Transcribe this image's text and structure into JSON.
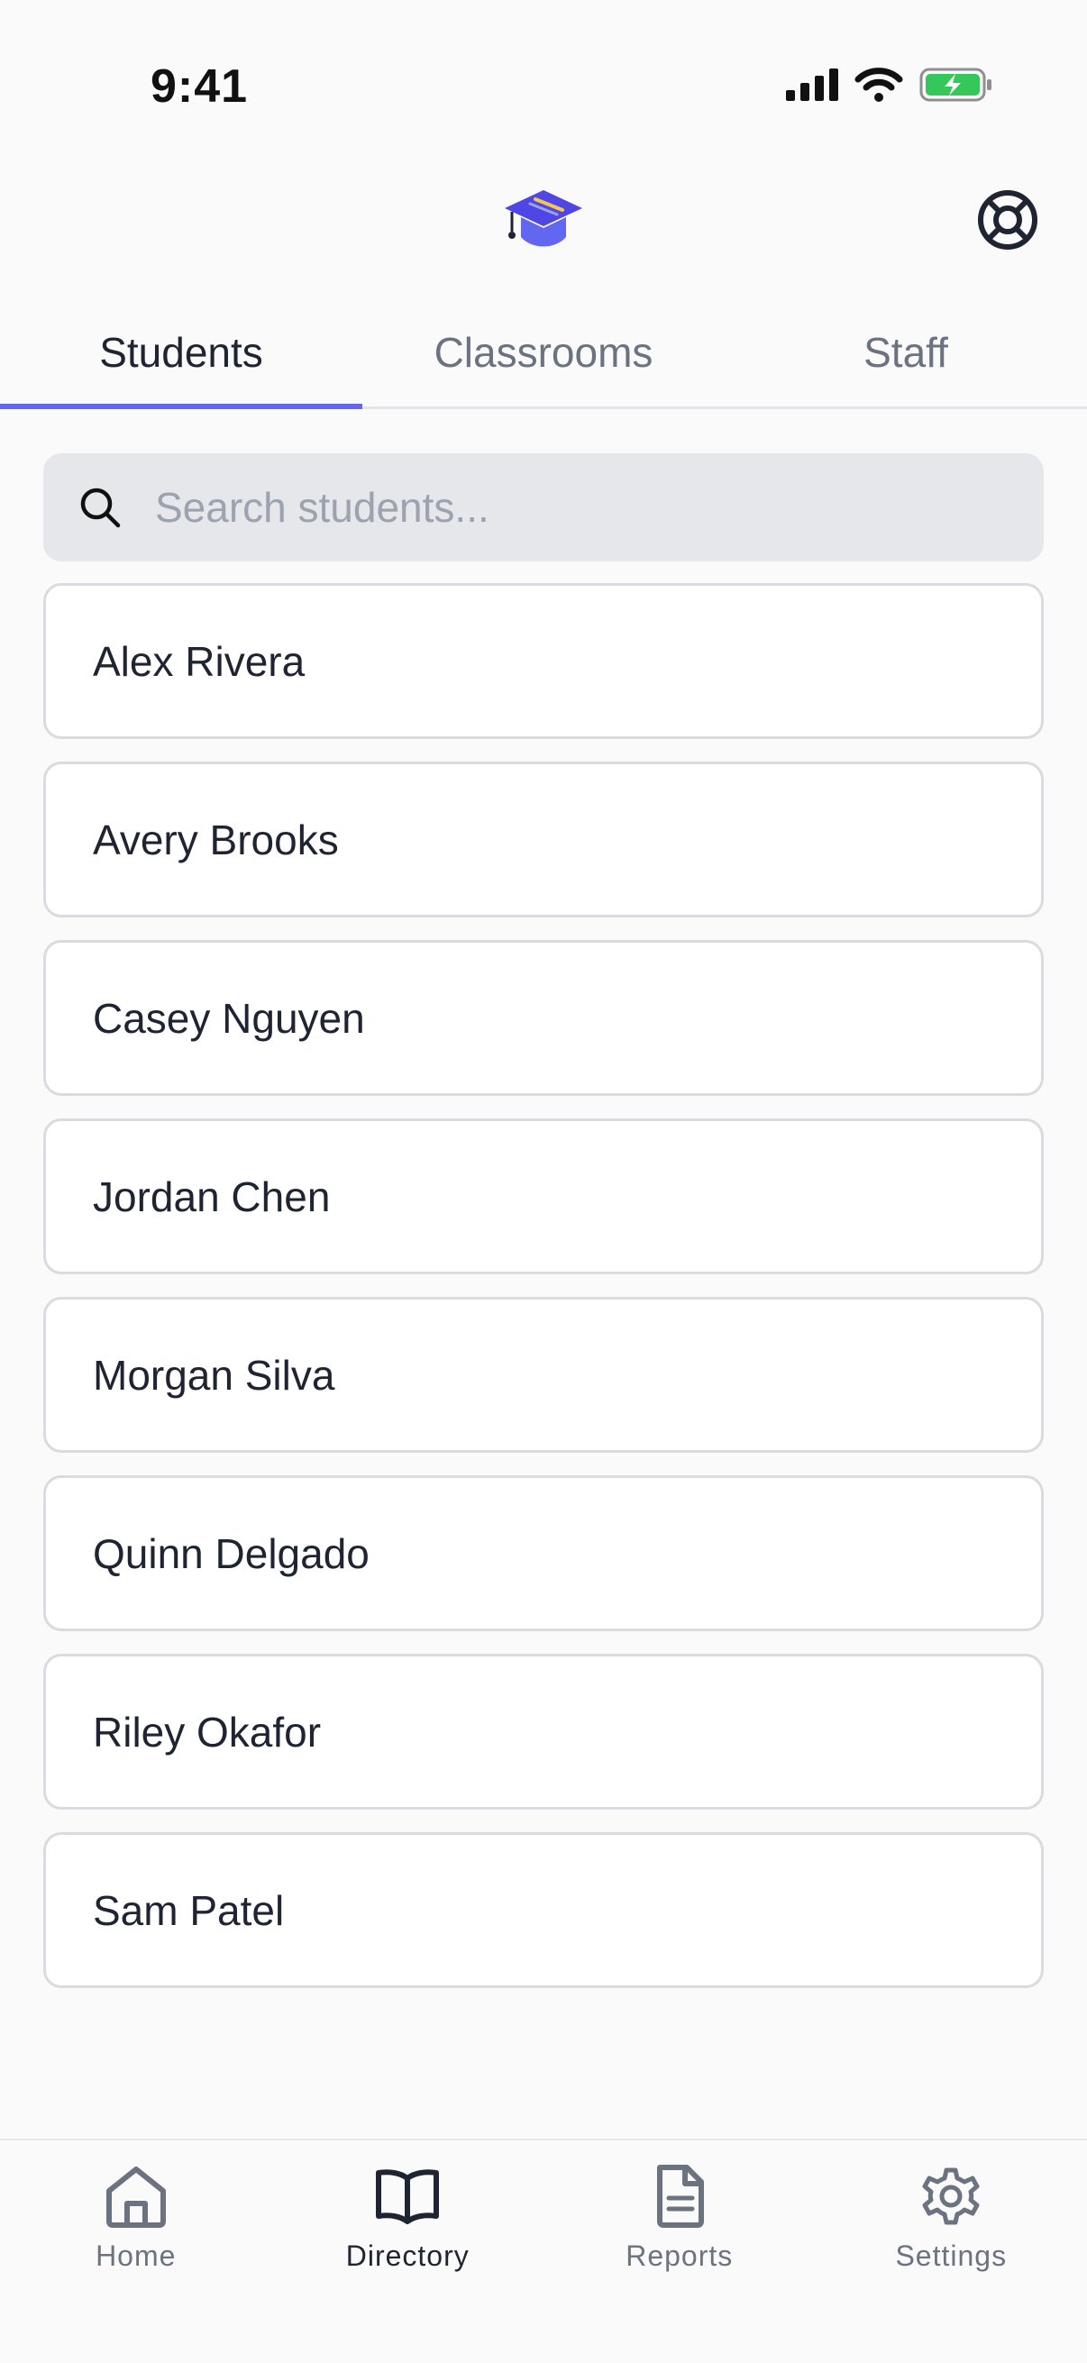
{
  "status_bar": {
    "time": "9:41"
  },
  "header": {
    "logo_icon": "graduation-cap-icon",
    "help_icon": "lifebuoy-icon"
  },
  "tabs": [
    {
      "label": "Students",
      "active": true
    },
    {
      "label": "Classrooms",
      "active": false
    },
    {
      "label": "Staff",
      "active": false
    }
  ],
  "search": {
    "placeholder": "Search students...",
    "value": ""
  },
  "students": [
    {
      "name": "Alex Rivera"
    },
    {
      "name": "Avery Brooks"
    },
    {
      "name": "Casey Nguyen"
    },
    {
      "name": "Jordan Chen"
    },
    {
      "name": "Morgan Silva"
    },
    {
      "name": "Quinn Delgado"
    },
    {
      "name": "Riley Okafor"
    },
    {
      "name": "Sam Patel"
    }
  ],
  "bottom_nav": [
    {
      "label": "Home",
      "icon": "home-icon",
      "active": false
    },
    {
      "label": "Directory",
      "icon": "book-open-icon",
      "active": true
    },
    {
      "label": "Reports",
      "icon": "document-icon",
      "active": false
    },
    {
      "label": "Settings",
      "icon": "gear-icon",
      "active": false
    }
  ],
  "colors": {
    "accent": "#6366f1",
    "battery": "#34c759"
  }
}
